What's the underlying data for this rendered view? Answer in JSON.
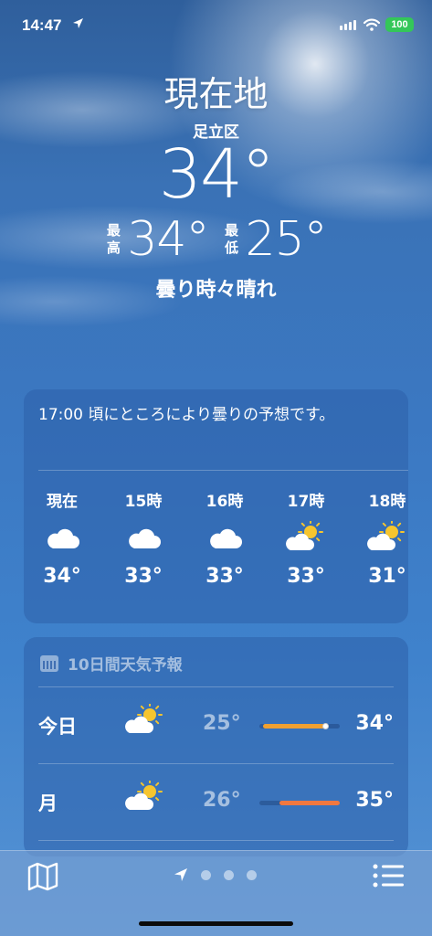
{
  "status_bar": {
    "time": "14:47",
    "battery": "100",
    "location_icon": "location-arrow-icon"
  },
  "header": {
    "location": "現在地",
    "district": "足立区",
    "temperature": "34°",
    "high_label": "最\n高",
    "high_value": "34°",
    "low_label": "最\n低",
    "low_value": "25°",
    "condition": "曇り時々晴れ"
  },
  "hourly": {
    "summary": "17:00 頃にところにより曇りの予想です。",
    "items": [
      {
        "label": "現在",
        "icon": "cloud-icon",
        "temp": "34°"
      },
      {
        "label": "15時",
        "icon": "cloud-icon",
        "temp": "33°"
      },
      {
        "label": "16時",
        "icon": "cloud-icon",
        "temp": "33°"
      },
      {
        "label": "17時",
        "icon": "partly-sunny-icon",
        "temp": "33°"
      },
      {
        "label": "18時",
        "icon": "partly-sunny-icon",
        "temp": "31°"
      }
    ]
  },
  "daily": {
    "title": "10日間天気予報",
    "items": [
      {
        "day": "今日",
        "icon": "partly-sunny-icon",
        "low": "25°",
        "high": "34°",
        "range_start": 0.05,
        "range_end": 0.85,
        "current": 0.82,
        "bar_color": "#f0a030"
      },
      {
        "day": "月",
        "icon": "partly-sunny-icon",
        "low": "26°",
        "high": "35°",
        "range_start": 0.25,
        "range_end": 1.0,
        "bar_color": "#f07840"
      }
    ]
  },
  "tabbar": {
    "map_icon": "map-icon",
    "list_icon": "list-icon",
    "pages": 4,
    "active_page": 0
  }
}
